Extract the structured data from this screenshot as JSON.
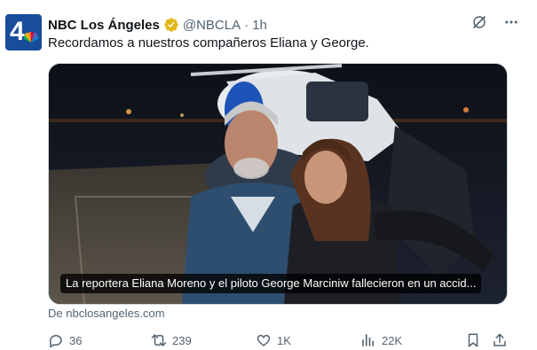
{
  "account": {
    "name": "NBC Los Ángeles",
    "handle": "@NBCLA",
    "separator": "·",
    "time": "1h",
    "avatar_text": "4"
  },
  "tweet": {
    "text": "Recordamos a nuestros compañeros Eliana y George.",
    "media_caption": "La reportera Eliana Moreno y el piloto George Marciniw fallecieron en un accid...",
    "source": "De nbclosangeles.com"
  },
  "actions": {
    "replies": "36",
    "reposts": "239",
    "likes": "1K",
    "views": "22K"
  },
  "icons": {
    "verified": "verified-badge-icon",
    "grok": "grok-icon",
    "more": "more-icon",
    "reply": "reply-icon",
    "repost": "repost-icon",
    "like": "like-icon",
    "views": "views-icon",
    "bookmark": "bookmark-icon",
    "share": "share-icon"
  },
  "colors": {
    "brand_blue": "#1a4c9c",
    "verified_gold": "#e2b719",
    "secondary_text": "#536471"
  }
}
